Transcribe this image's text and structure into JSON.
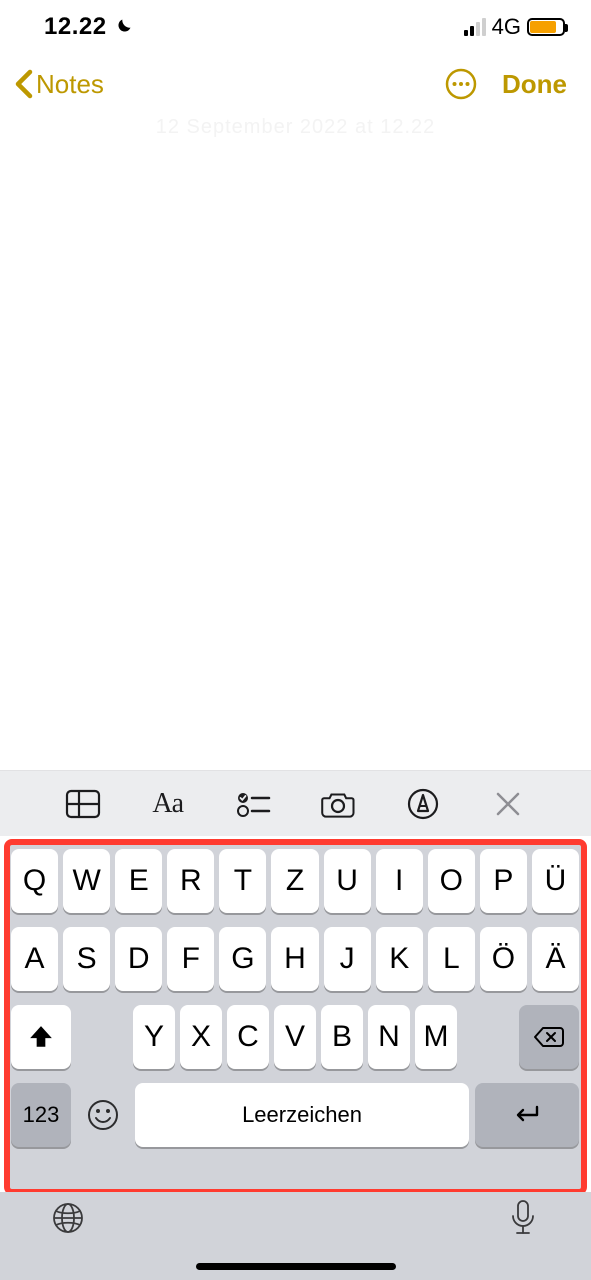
{
  "status": {
    "time": "12.22",
    "network": "4G"
  },
  "nav": {
    "back_label": "Notes",
    "done_label": "Done"
  },
  "note": {
    "timestamp": "12 September 2022 at 12.22"
  },
  "keyboard": {
    "row1": [
      "Q",
      "W",
      "E",
      "R",
      "T",
      "Z",
      "U",
      "I",
      "O",
      "P",
      "Ü"
    ],
    "row2": [
      "A",
      "S",
      "D",
      "F",
      "G",
      "H",
      "J",
      "K",
      "L",
      "Ö",
      "Ä"
    ],
    "row3": [
      "Y",
      "X",
      "C",
      "V",
      "B",
      "N",
      "M"
    ],
    "numkey": "123",
    "space": "Leerzeichen"
  }
}
